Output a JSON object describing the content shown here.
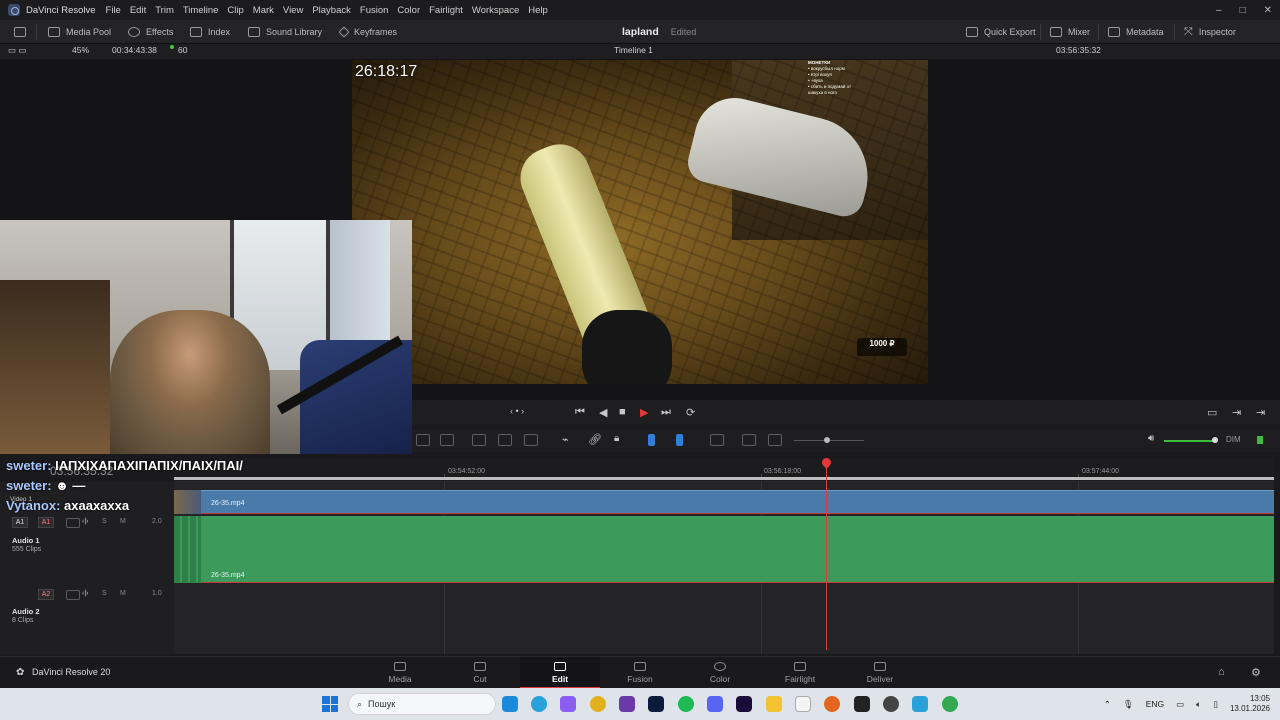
{
  "menubar": {
    "app_title": "DaVinci Resolve",
    "items": [
      "File",
      "Edit",
      "Trim",
      "Timeline",
      "Clip",
      "Mark",
      "View",
      "Playback",
      "Fusion",
      "Color",
      "Fairlight",
      "Workspace",
      "Help"
    ],
    "window_buttons": [
      "–",
      "□",
      "✕"
    ]
  },
  "toolbar": {
    "media_pool": "Media Pool",
    "effects": "Effects",
    "index": "Index",
    "sound_library": "Sound Library",
    "keyframes": "Keyframes",
    "project_name": "lapland",
    "project_status": "Edited",
    "quick_export": "Quick Export",
    "mixer": "Mixer",
    "metadata": "Metadata",
    "inspector": "Inspector"
  },
  "viewer_header": {
    "zoom": "45%",
    "duration": "00:34:43:38",
    "fps": "60",
    "timeline_name": "Timeline 1",
    "current_timecode": "03:56:35:32"
  },
  "video_overlay": {
    "stream_time": "26:18:17",
    "chat_title": "МОНЕТКИ",
    "chat_lines": [
      "• вокрусбыл норм",
      "• Юрі вохуя",
      "• +вуха",
      "• сбить и подумай от",
      "шакуха в ного"
    ],
    "donation": "1000 ₽"
  },
  "chat_overlay": {
    "ghost_timecode": "03:56:35:32",
    "lines": [
      {
        "name": "sweter:",
        "text": " ІАПХІХАПАХІПАПІХ/ПАІХ/ПАІ/"
      },
      {
        "name": "sweter:",
        "text": " ☻ —"
      },
      {
        "name": "Vytanox:",
        "text": " ахаахахха"
      }
    ]
  },
  "ruler": {
    "timecodes": [
      "03:54:52:00",
      "03:56:18:00",
      "03:57:44:00"
    ]
  },
  "tracks": {
    "video": {
      "label": "Video 1",
      "clip_name": "26-35.mp4"
    },
    "audio1": {
      "tag": "A1",
      "tag2": "A1",
      "label": "Audio 1",
      "clips": "555 Clips",
      "level": "2.0",
      "clip_name": "26-35.mp4"
    },
    "audio2": {
      "tag": "A2",
      "label": "Audio 2",
      "clips": "8 Clips",
      "level": "1.0"
    },
    "solo": "S",
    "mute": "M"
  },
  "edit_tools": {
    "dim_label": "DIM"
  },
  "pages": {
    "product": "DaVinci Resolve 20",
    "tabs": [
      "Media",
      "Cut",
      "Edit",
      "Fusion",
      "Color",
      "Fairlight",
      "Deliver"
    ],
    "active": "Edit"
  },
  "taskbar": {
    "search_placeholder": "Пошук",
    "lang": "ENG",
    "time": "13:05",
    "date": "13.01.2026"
  },
  "colors": {
    "accent_red": "#e23a3a",
    "video_clip": "#4a7ba8",
    "audio_clip": "#3c9a5a"
  }
}
